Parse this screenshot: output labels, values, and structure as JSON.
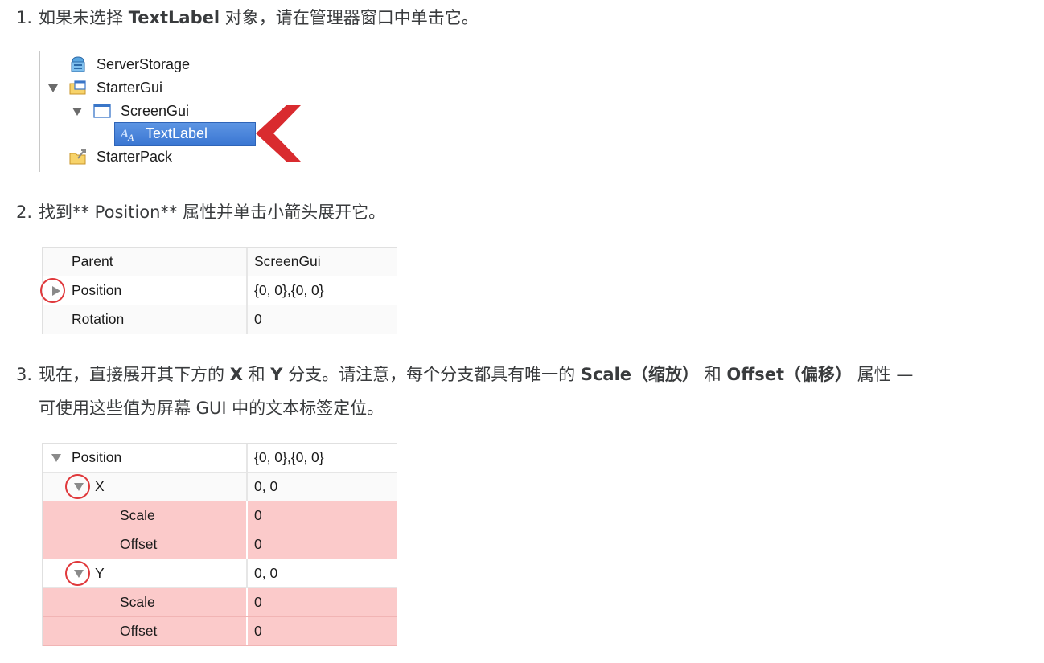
{
  "steps": {
    "s1": {
      "num": "1.",
      "pre": "如果未选择 ",
      "bold": "TextLabel",
      "post": " 对象，请在管理器窗口中单击它。"
    },
    "s2": {
      "num": "2.",
      "text": "找到** Position** 属性并单击小箭头展开它。"
    },
    "s3": {
      "num": "3.",
      "t1": "现在，直接展开其下方的 ",
      "b1": "X",
      "t2": " 和 ",
      "b2": "Y",
      "t3": " 分支。请注意，每个分支都具有唯一的 ",
      "b3": "Scale（缩放）",
      "t4": " 和 ",
      "b4": "Offset（偏移）",
      "t5": " 属性 —",
      "line2": "可使用这些值为屏幕 GUI 中的文本标签定位。"
    }
  },
  "explorer": {
    "items": [
      {
        "label": "ServerStorage",
        "icon": "server-storage-icon"
      },
      {
        "label": "StarterGui",
        "icon": "starter-gui-icon"
      },
      {
        "label": "ScreenGui",
        "icon": "screen-gui-icon"
      },
      {
        "label": "TextLabel",
        "icon": "text-label-icon",
        "selected": true
      },
      {
        "label": "StarterPack",
        "icon": "starter-pack-icon"
      }
    ],
    "selected_color": "#3f7bd5",
    "pointer_color": "#d92b2f"
  },
  "table1": {
    "rows": [
      {
        "name": "Parent",
        "value": "ScreenGui"
      },
      {
        "name": "Position",
        "value": "{0, 0},{0, 0}"
      },
      {
        "name": "Rotation",
        "value": "0"
      }
    ]
  },
  "table2": {
    "rows": [
      {
        "name": "Position",
        "value": "{0, 0},{0, 0}"
      },
      {
        "name": "X",
        "value": "0, 0"
      },
      {
        "name": "Scale",
        "value": "0"
      },
      {
        "name": "Offset",
        "value": "0"
      },
      {
        "name": "Y",
        "value": "0, 0"
      },
      {
        "name": "Scale",
        "value": "0"
      },
      {
        "name": "Offset",
        "value": "0"
      }
    ],
    "highlight_color": "#fbcaca"
  },
  "highlight_ring_color": "#e0393c"
}
